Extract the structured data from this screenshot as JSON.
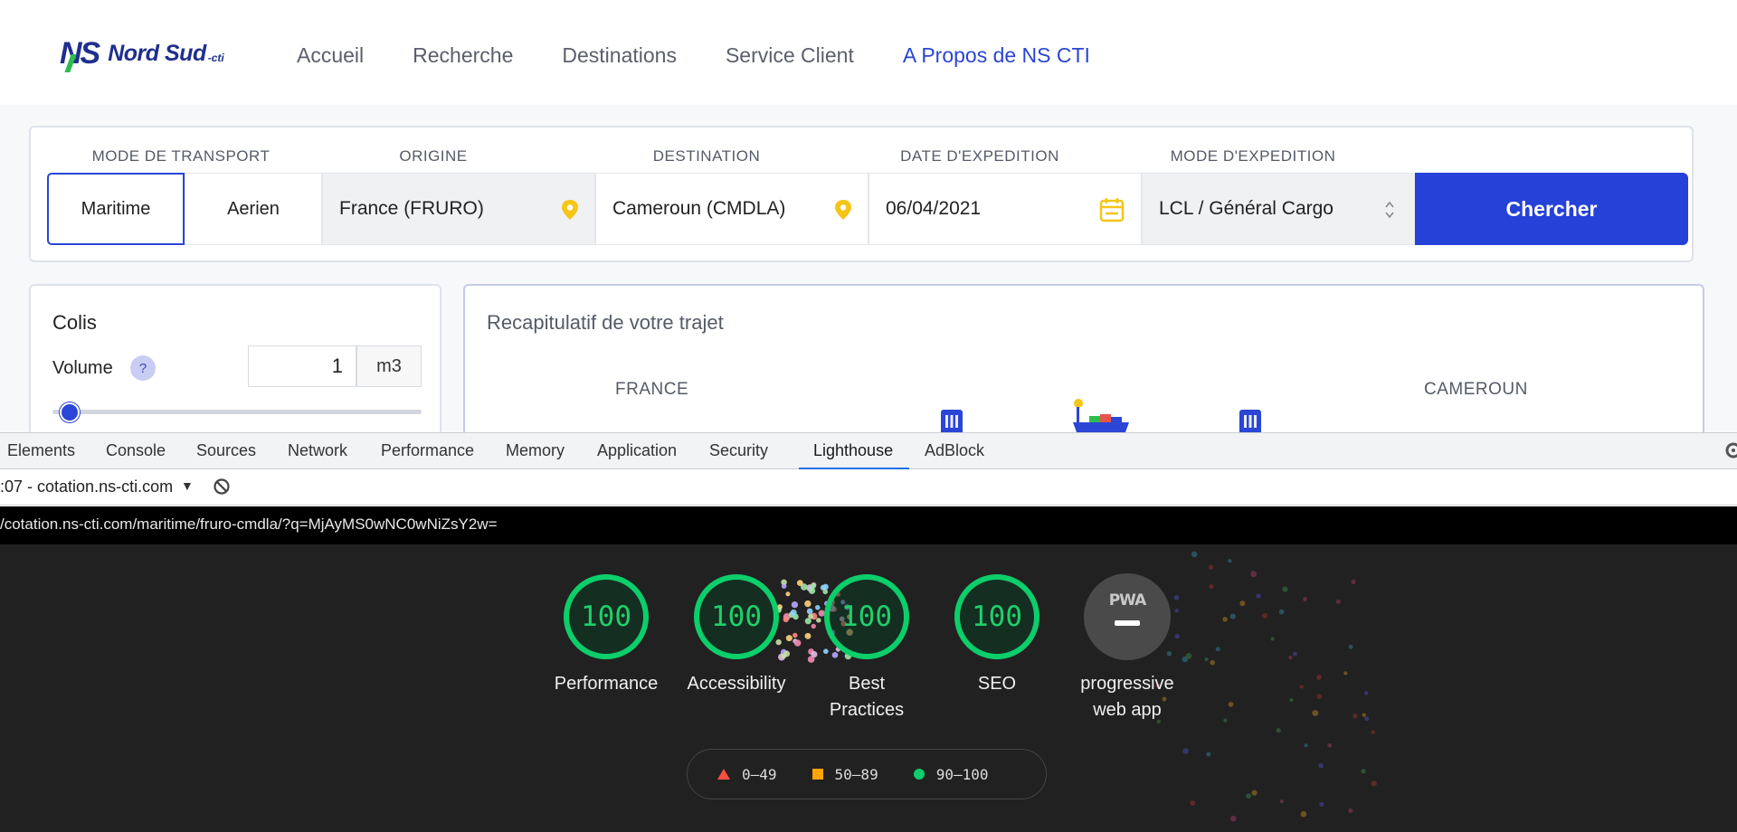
{
  "site": {
    "logo": {
      "ns": "NS",
      "name": "Nord Sud",
      "suffix": "-cti"
    },
    "nav": [
      {
        "label": "Accueil"
      },
      {
        "label": "Recherche"
      },
      {
        "label": "Destinations"
      },
      {
        "label": "Service Client"
      },
      {
        "label": "A Propos de NS CTI"
      }
    ],
    "search": {
      "labels": {
        "mode": "MODE DE TRANSPORT",
        "origin": "ORIGINE",
        "destination": "DESTINATION",
        "date": "DATE D'EXPEDITION",
        "expedition": "MODE D'EXPEDITION"
      },
      "mode_options": [
        "Maritime",
        "Aerien"
      ],
      "selected_mode": "Maritime",
      "origin_value": "France (FRURO)",
      "destination_value": "Cameroun (CMDLA)",
      "date_value": "06/04/2021",
      "expedition_value": "LCL / Général Cargo",
      "submit_label": "Chercher"
    },
    "colis": {
      "title": "Colis",
      "volume_label": "Volume",
      "help": "?",
      "volume_value": "1",
      "volume_unit": "m3",
      "slider_level": 0.02
    },
    "recap": {
      "title": "Recapitulatif de votre trajet",
      "from_country": "FRANCE",
      "to_country": "CAMEROUN"
    }
  },
  "devtools": {
    "tabs": [
      "Elements",
      "Console",
      "Sources",
      "Network",
      "Performance",
      "Memory",
      "Application",
      "Security",
      "Lighthouse",
      "AdBlock"
    ],
    "active_tab": "Lighthouse",
    "report_selector": ":07 - cotation.ns-cti.com",
    "url": "/cotation.ns-cti.com/maritime/fruro-cmdla/?q=MjAyMS0wNC0wNiZsY2w=",
    "scores": [
      {
        "value": "100",
        "label": "Performance"
      },
      {
        "value": "100",
        "label": "Accessibility"
      },
      {
        "value": "100",
        "label": "Best Practices"
      },
      {
        "value": "100",
        "label": "SEO"
      }
    ],
    "pwa": {
      "badge": "PWA",
      "label": "progressive web app"
    },
    "legend": [
      {
        "range": "0–49",
        "color": "#ff4e42"
      },
      {
        "range": "50–89",
        "color": "#ffa400"
      },
      {
        "range": "90–100",
        "color": "#0cce6b"
      }
    ]
  },
  "colors": {
    "brand": "#2541d8",
    "pin": "#f5c518",
    "pass": "#0cce6b"
  }
}
